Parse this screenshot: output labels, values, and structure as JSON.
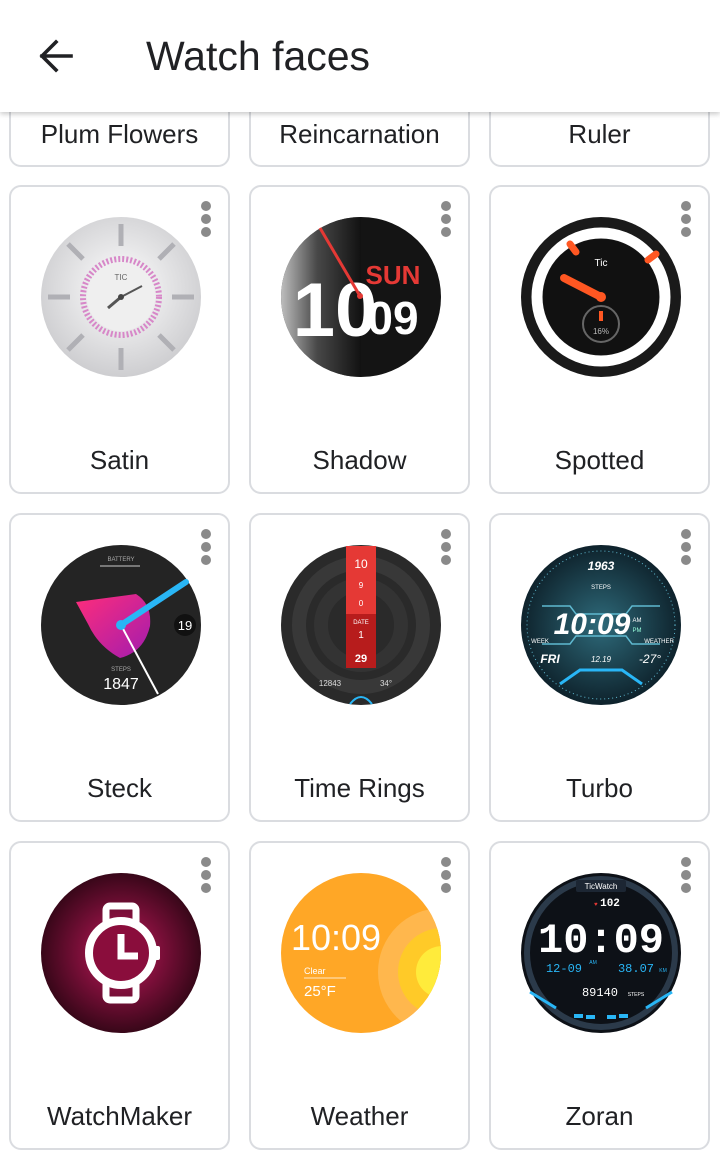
{
  "app_bar": {
    "title": "Watch faces",
    "back_icon": "arrow-back-icon"
  },
  "top_row": [
    {
      "label": "Plum Flowers"
    },
    {
      "label": "Reincarnation"
    },
    {
      "label": "Ruler"
    }
  ],
  "faces": [
    {
      "label": "Satin",
      "watch_text": {
        "brand": "TIC"
      }
    },
    {
      "label": "Shadow",
      "watch_text": {
        "hour": "10",
        "day": "SUN",
        "date": "09"
      }
    },
    {
      "label": "Spotted",
      "watch_text": {
        "brand": "Tic",
        "battery": "16%"
      }
    },
    {
      "label": "Steck",
      "watch_text": {
        "battery": "BATTERY",
        "date": "19",
        "steps_label": "STEPS",
        "steps": "1847"
      }
    },
    {
      "label": "Time Rings",
      "watch_text": {
        "hour": "10",
        "minute_a": "9",
        "minute_b": "0",
        "date_label": "DATE",
        "day_a": "1",
        "day_b": "29",
        "steps": "12843",
        "temp": "34°"
      }
    },
    {
      "label": "Turbo",
      "watch_text": {
        "year": "1963",
        "steps_label": "STEPS",
        "time": "10:09",
        "am": "AM",
        "pm": "PM",
        "week_label": "WEEK",
        "day": "FRI",
        "date": "12.19",
        "weather_label": "WEATHER",
        "temp": "-27°"
      }
    },
    {
      "label": "WatchMaker",
      "watch_text": {}
    },
    {
      "label": "Weather",
      "watch_text": {
        "time": "10:09",
        "condition": "Clear",
        "temp": "25°F"
      }
    },
    {
      "label": "Zoran",
      "watch_text": {
        "brand": "TicWatch",
        "heart": "102",
        "time": "10:09",
        "date": "12-09",
        "am": "AM",
        "distance": "38.07",
        "km": "KM",
        "steps": "89140",
        "steps_label": "STEPS"
      }
    }
  ],
  "colors": {
    "card_border": "#dadce0",
    "menu_dots": "#8a8a8a",
    "text": "#202124"
  }
}
